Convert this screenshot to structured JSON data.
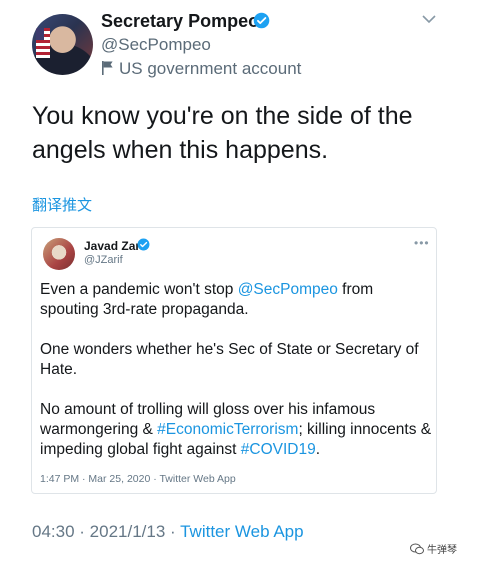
{
  "author": {
    "name": "Secretary Pompeo",
    "handle": "@SecPompeo",
    "account_label": "US government account"
  },
  "tweet": {
    "line1": "You know you're on the side of the",
    "line2": "angels when this happens.",
    "translate_label": "翻译推文"
  },
  "quoted": {
    "name": "Javad Zarif",
    "handle": "@JZarif",
    "p1_pre": "Even a pandemic won't stop ",
    "p1_mention": "@SecPompeo",
    "p1_post": " from spouting 3rd-rate propaganda.",
    "p2": "One wonders whether he's Sec of State or Secretary of Hate.",
    "p3_pre": "No amount of trolling will gloss over his infamous warmongering & ",
    "p3_tag1": "#EconomicTerrorism",
    "p3_mid": "; killing innocents & impeding global fight against ",
    "p3_tag2": "#COVID19",
    "p3_end": ".",
    "meta": "1:47 PM · Mar 25, 2020 · Twitter Web App"
  },
  "footer": {
    "time": "04:30",
    "date": "2021/1/13",
    "app": "Twitter Web App",
    "sep": " · "
  },
  "watermark": {
    "label": "牛弹琴"
  },
  "colors": {
    "link": "#1b95e0",
    "verified": "#1da1f2",
    "muted": "#657786"
  }
}
